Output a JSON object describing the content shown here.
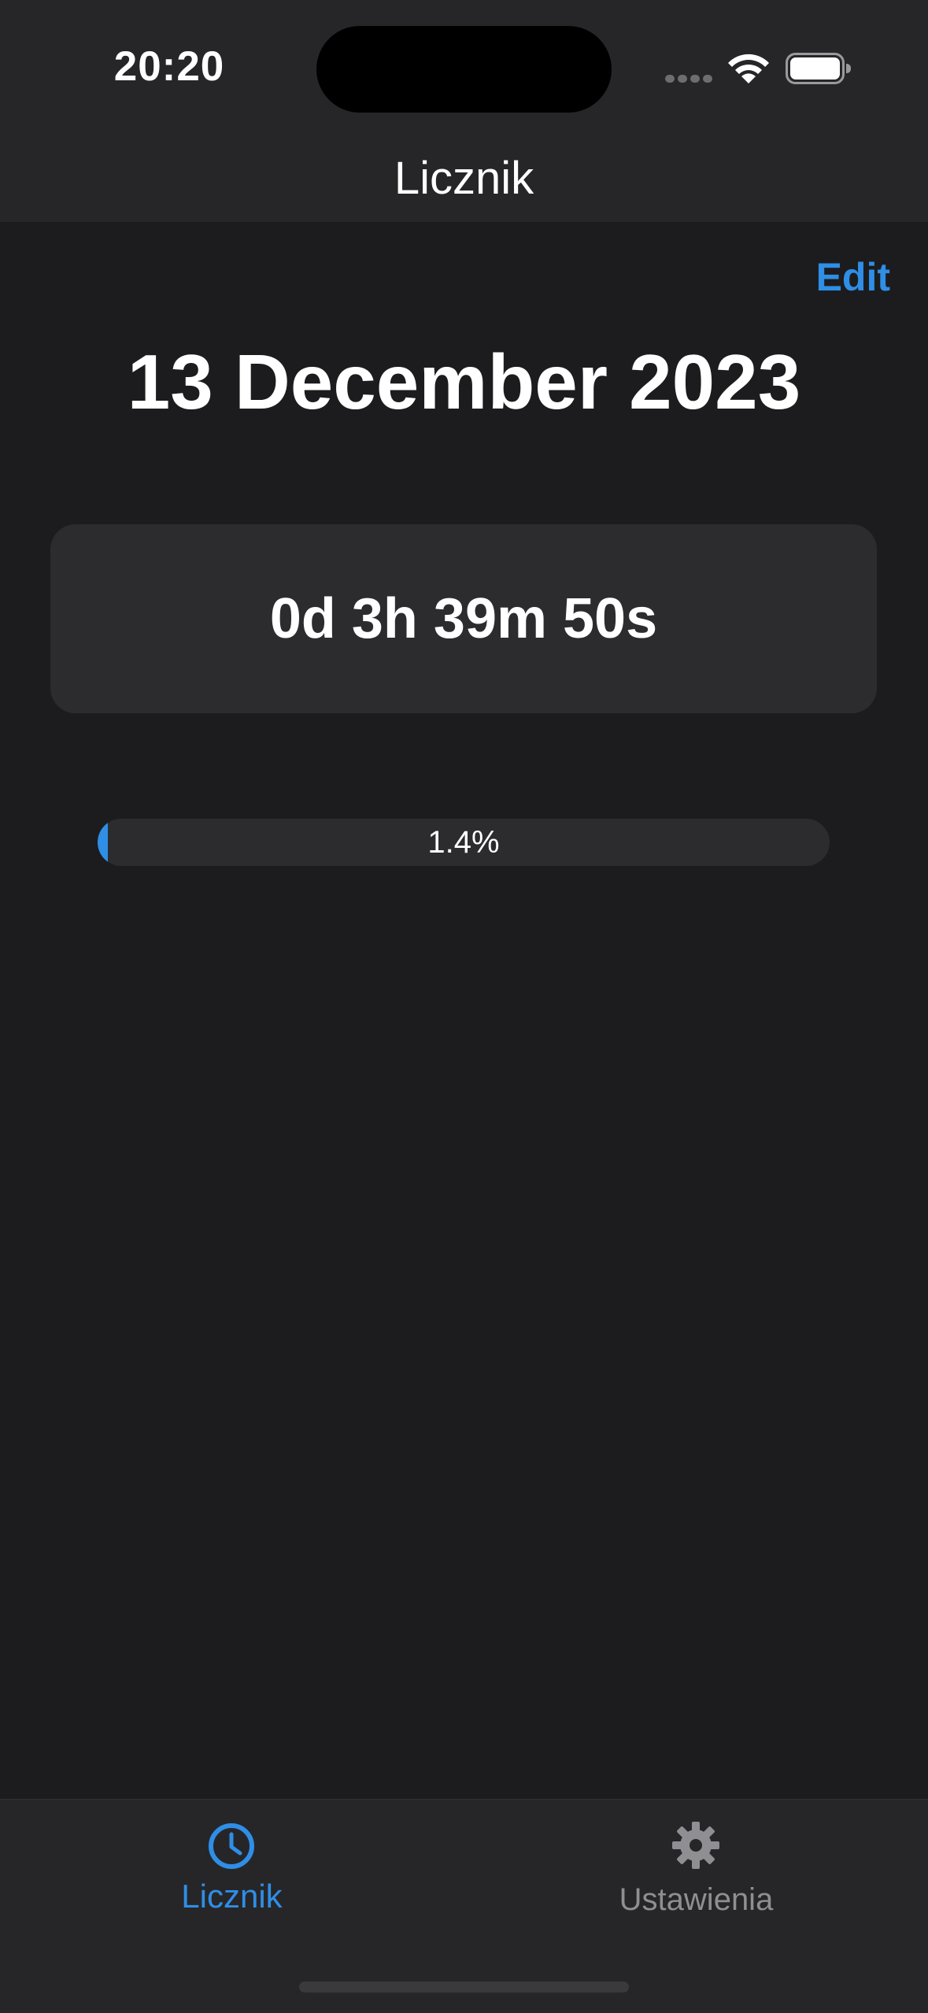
{
  "status_bar": {
    "time": "20:20"
  },
  "nav": {
    "title": "Licznik",
    "edit_label": "Edit"
  },
  "main": {
    "date": "13 December 2023",
    "counter": "0d 3h 39m 50s",
    "progress_label": "1.4%",
    "progress_fraction": 0.014
  },
  "tabs": [
    {
      "label": "Licznik",
      "icon": "clock-icon",
      "active": true
    },
    {
      "label": "Ustawienia",
      "icon": "gear-icon",
      "active": false
    }
  ],
  "colors": {
    "accent": "#2f8ee6",
    "background": "#1c1c1e",
    "bar_background": "#262628",
    "card_background": "#2c2c2e",
    "inactive_tab": "#8e8e93"
  }
}
